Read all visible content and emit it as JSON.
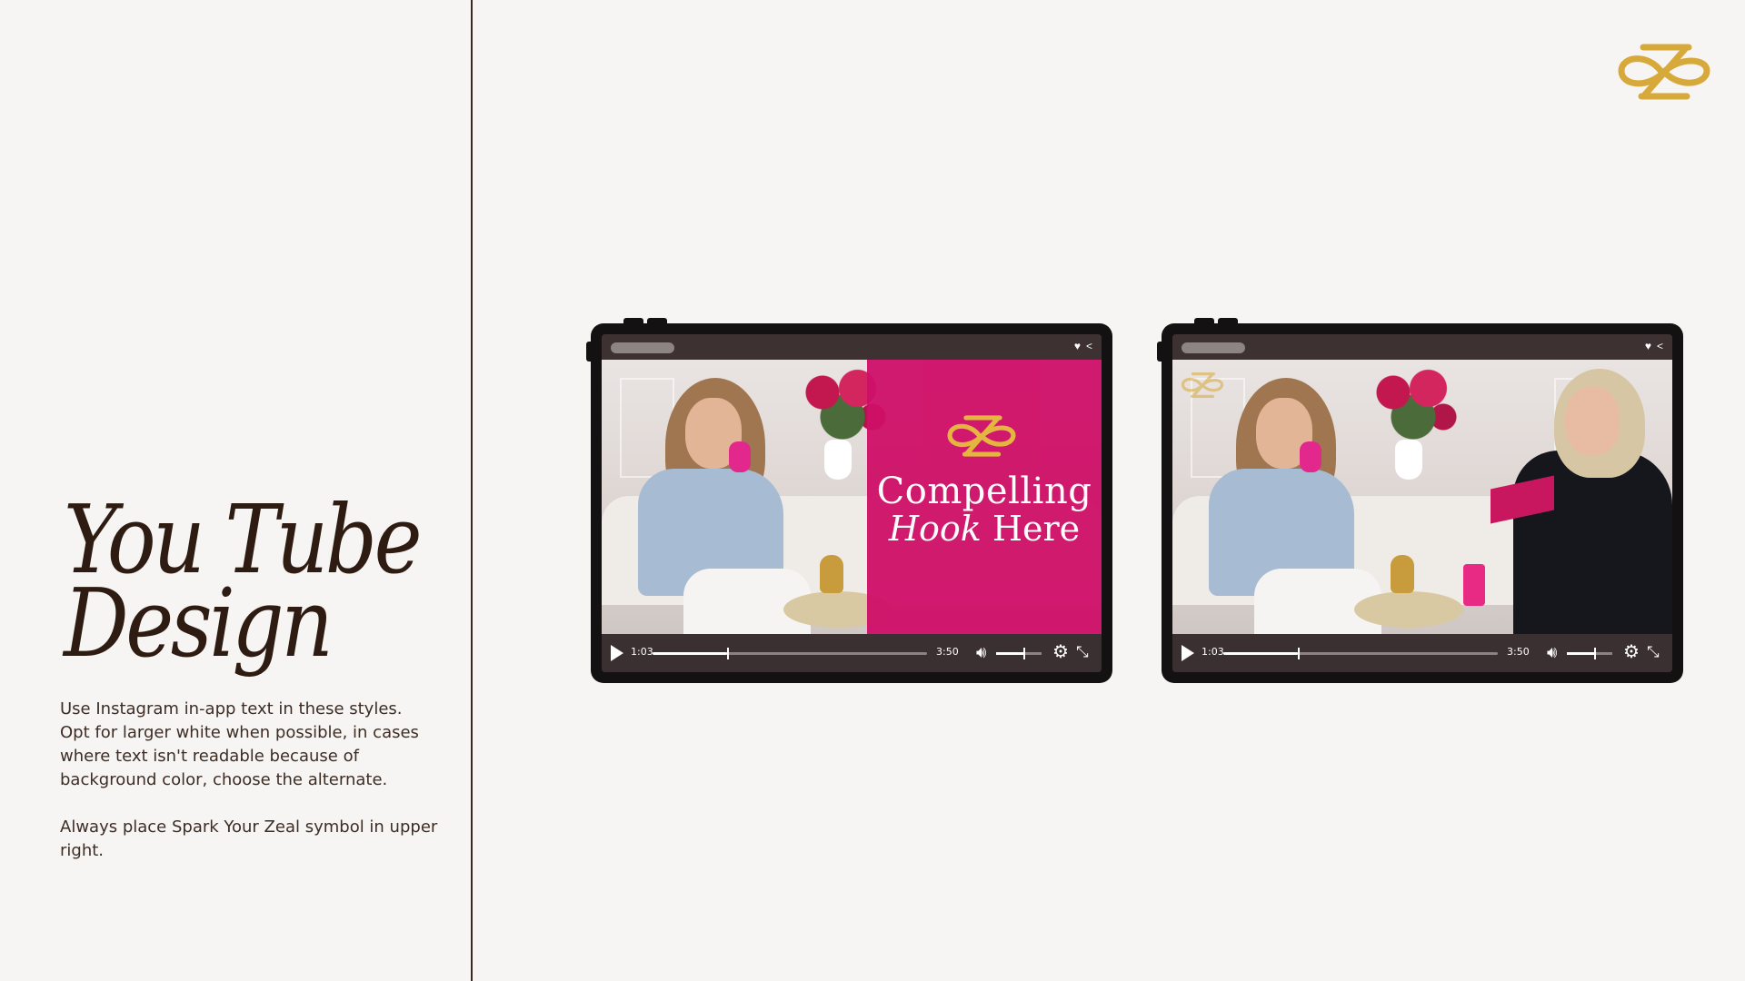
{
  "title": {
    "line1": "You Tube",
    "line2": "Design"
  },
  "description": "Use Instagram in-app text in these styles.\nOpt for larger white when possible, in cases\nwhere text isn't readable because of\nbackground color, choose the alternate.\n\nAlways place Spark Your Zeal symbol in upper\nright.",
  "brand": {
    "logo_icon": "spark-your-zeal-symbol",
    "gold": "#d7a93a",
    "pink": "#cf0f68"
  },
  "players": [
    {
      "overlay": {
        "line1": "Compelling",
        "line2_italic": "Hook",
        "line2_rest": "Here"
      },
      "controls": {
        "current_time": "1:03",
        "duration": "3:50",
        "progress": 0.27,
        "volume": 0.6
      },
      "topbar_icons": [
        "heart-icon",
        "share-icon"
      ]
    },
    {
      "controls": {
        "current_time": "1:03",
        "duration": "3:50",
        "progress": 0.27,
        "volume": 0.6
      },
      "topbar_icons": [
        "heart-icon",
        "share-icon"
      ]
    }
  ]
}
